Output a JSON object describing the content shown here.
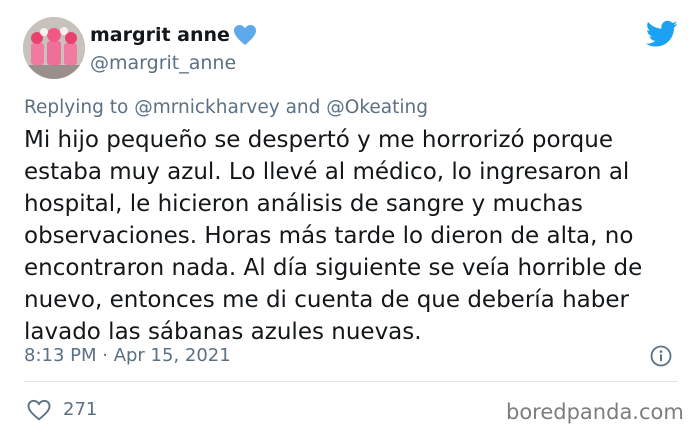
{
  "user": {
    "display_name": "margrit anne",
    "handle": "@margrit_anne",
    "verified_emoji": "blue-heart-icon"
  },
  "reply": {
    "prefix": "Replying to",
    "mention_1": "@mrnickharvey",
    "conjunction": "and",
    "mention_2": "@Okeating"
  },
  "tweet": {
    "lines": [
      "Mi hijo pequeño se despertó y me horrorizó porque",
      "estaba muy azul. Lo llevé al médico, lo ingresaron al",
      "hospital, le hicieron análisis de sangre y muchas",
      "observaciones. Horas más tarde lo dieron de alta, no",
      "encontraron nada. Al día siguiente se veía horrible de",
      "nuevo, entonces me di cuenta de que debería haber",
      "lavado las sábanas azules nuevas."
    ],
    "timestamp": "8:13 PM · Apr 15, 2021"
  },
  "stats": {
    "likes": "271"
  },
  "watermark": "boredpanda.com",
  "colors": {
    "text": "#14171a",
    "secondary": "#5b7083",
    "twitter_blue": "#1da1f2",
    "divider": "#dfe5ea"
  }
}
